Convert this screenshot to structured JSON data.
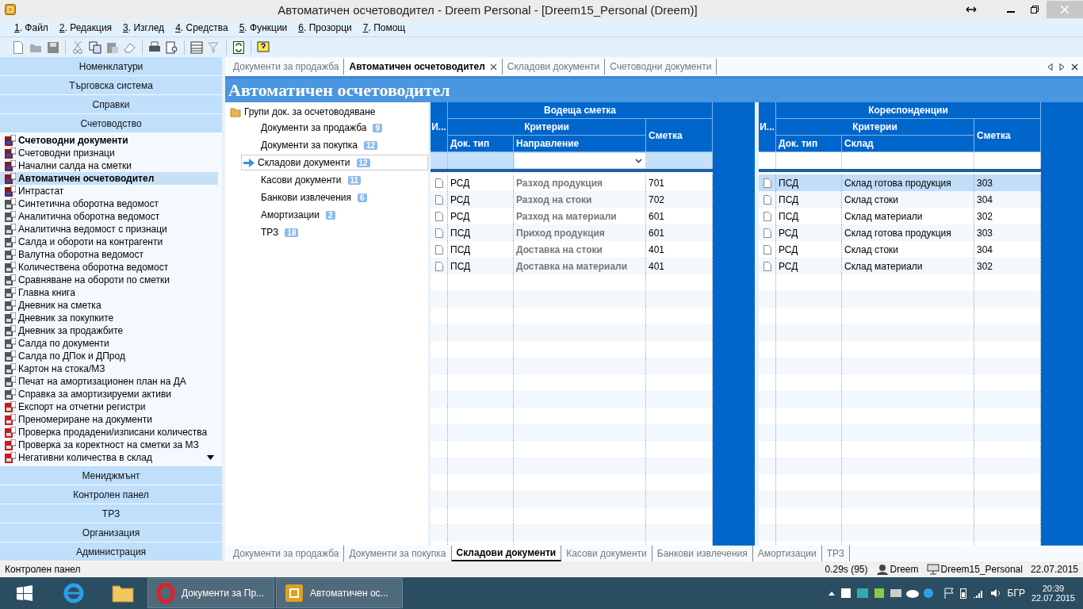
{
  "window": {
    "title": "Автоматичен осчетоводител - Dreem Personal - [Dreem15_Personal (Dreem)]"
  },
  "menu": [
    {
      "key": "1",
      "label": ". Файл"
    },
    {
      "key": "2",
      "label": ". Редакция"
    },
    {
      "key": "3",
      "label": ". Изглед"
    },
    {
      "key": "4",
      "label": ". Средства"
    },
    {
      "key": "5",
      "label": ". Функции"
    },
    {
      "key": "6",
      "label": ". Прозорци"
    },
    {
      "key": "7",
      "label": ". Помощ"
    }
  ],
  "sidebar": {
    "sections_top": [
      "Номенклатури",
      "Търговска система",
      "Справки",
      "Счетоводство"
    ],
    "items": [
      {
        "label": "Счетоводни документи",
        "kind": "ledger",
        "bold": true,
        "selected": false
      },
      {
        "label": "Счетоводни признаци",
        "kind": "ledger",
        "bold": false,
        "selected": false
      },
      {
        "label": "Начални салда на сметки",
        "kind": "ledger",
        "bold": false,
        "selected": false
      },
      {
        "label": "Автоматичен осчетоводител",
        "kind": "ledger",
        "bold": true,
        "selected": true
      },
      {
        "label": "Интрастат",
        "kind": "ledger",
        "bold": false,
        "selected": false
      },
      {
        "label": "Синтетична оборотна ведомост",
        "kind": "report",
        "bold": false,
        "selected": false
      },
      {
        "label": "Аналитична оборотна ведомост",
        "kind": "report",
        "bold": false,
        "selected": false
      },
      {
        "label": "Аналитична ведомост с признаци",
        "kind": "report",
        "bold": false,
        "selected": false
      },
      {
        "label": "Салда и обороти на контрагенти",
        "kind": "report",
        "bold": false,
        "selected": false
      },
      {
        "label": "Валутна оборотна ведомост",
        "kind": "report",
        "bold": false,
        "selected": false
      },
      {
        "label": "Количествена оборотна ведомост",
        "kind": "report",
        "bold": false,
        "selected": false
      },
      {
        "label": "Сравняване на обороти по сметки",
        "kind": "report",
        "bold": false,
        "selected": false
      },
      {
        "label": "Главна книга",
        "kind": "report",
        "bold": false,
        "selected": false
      },
      {
        "label": "Дневник на сметка",
        "kind": "report",
        "bold": false,
        "selected": false
      },
      {
        "label": "Дневник за покупките",
        "kind": "report",
        "bold": false,
        "selected": false
      },
      {
        "label": "Дневник за продажбите",
        "kind": "report",
        "bold": false,
        "selected": false
      },
      {
        "label": "Салда по документи",
        "kind": "report",
        "bold": false,
        "selected": false
      },
      {
        "label": "Салда по ДПок и ДПрод",
        "kind": "report",
        "bold": false,
        "selected": false
      },
      {
        "label": "Картон на стока/МЗ",
        "kind": "report",
        "bold": false,
        "selected": false
      },
      {
        "label": "Печат на амортизационен план на ДА",
        "kind": "report",
        "bold": false,
        "selected": false
      },
      {
        "label": "Справка за амортизируеми активи",
        "kind": "report",
        "bold": false,
        "selected": false
      },
      {
        "label": "Експорт на отчетни регистри",
        "kind": "function",
        "bold": false,
        "selected": false
      },
      {
        "label": "Преномериране на документи",
        "kind": "function",
        "bold": false,
        "selected": false
      },
      {
        "label": "Проверка продадени/изписани количества",
        "kind": "function",
        "bold": false,
        "selected": false
      },
      {
        "label": "Проверка за коректност на сметки за МЗ",
        "kind": "function",
        "bold": false,
        "selected": false
      },
      {
        "label": "Негативни количества в склад",
        "kind": "function",
        "bold": false,
        "selected": false
      }
    ],
    "sections_bottom": [
      "Мениджмънт",
      "Контролен панел",
      "ТРЗ",
      "Организация",
      "Администрация"
    ]
  },
  "tabs": [
    {
      "label": "Документи за продажба",
      "selected": false,
      "closable": false
    },
    {
      "label": "Автоматичен осчетоводител",
      "selected": true,
      "closable": true
    },
    {
      "label": "Складови документи",
      "selected": false,
      "closable": false
    },
    {
      "label": "Счетоводни документи",
      "selected": false,
      "closable": false
    }
  ],
  "page_title": "Автоматичен осчетоводител",
  "tree": {
    "root": "Групи док. за осчетоводяване",
    "children": [
      {
        "label": "Документи за продажба",
        "count": "9",
        "selected": false
      },
      {
        "label": "Документи за покупка",
        "count": "12",
        "selected": false
      },
      {
        "label": "Складови документи",
        "count": "12",
        "selected": true
      },
      {
        "label": "Касови документи",
        "count": "11",
        "selected": false
      },
      {
        "label": "Банкови извлечения",
        "count": "6",
        "selected": false
      },
      {
        "label": "Амортизации",
        "count": "2",
        "selected": false
      },
      {
        "label": "ТРЗ",
        "count": "18",
        "selected": false
      }
    ]
  },
  "lead_grid": {
    "title": "Водеща сметка",
    "group": "Критерии",
    "columns": [
      "И...",
      "Док. тип",
      "Направление",
      "Сметка"
    ],
    "filter_dropdown": true,
    "rows": [
      {
        "doc_type": "РСД",
        "criterion": "Разход продукция",
        "account": "701",
        "selected": false
      },
      {
        "doc_type": "РСД",
        "criterion": "Разход на стоки",
        "account": "702",
        "selected": false
      },
      {
        "doc_type": "РСД",
        "criterion": "Разход на материали",
        "account": "601",
        "selected": false
      },
      {
        "doc_type": "ПСД",
        "criterion": "Приход продукция",
        "account": "601",
        "selected": false
      },
      {
        "doc_type": "ПСД",
        "criterion": "Доставка на стоки",
        "account": "401",
        "selected": false
      },
      {
        "doc_type": "ПСД",
        "criterion": "Доставка на материали",
        "account": "401",
        "selected": false
      }
    ]
  },
  "corr_grid": {
    "title": "Кореспонденции",
    "group": "Критерии",
    "columns": [
      "И...",
      "Док. тип",
      "Склад",
      "Сметка"
    ],
    "filter_dropdown": false,
    "rows": [
      {
        "doc_type": "ПСД",
        "criterion": "Склад готова продукция",
        "account": "303",
        "selected": true
      },
      {
        "doc_type": "ПСД",
        "criterion": "Склад стоки",
        "account": "304",
        "selected": false
      },
      {
        "doc_type": "ПСД",
        "criterion": "Склад материали",
        "account": "302",
        "selected": false
      },
      {
        "doc_type": "РСД",
        "criterion": "Склад готова продукция",
        "account": "303",
        "selected": false
      },
      {
        "doc_type": "РСД",
        "criterion": "Склад стоки",
        "account": "304",
        "selected": false
      },
      {
        "doc_type": "РСД",
        "criterion": "Склад материали",
        "account": "302",
        "selected": false
      }
    ]
  },
  "bottom_tabs": [
    {
      "label": "Документи за продажба",
      "selected": false
    },
    {
      "label": "Документи за покупка",
      "selected": false
    },
    {
      "label": "Складови документи",
      "selected": true
    },
    {
      "label": "Касови документи",
      "selected": false
    },
    {
      "label": "Банкови извлечения",
      "selected": false
    },
    {
      "label": "Амортизации",
      "selected": false
    },
    {
      "label": "ТРЗ",
      "selected": false
    }
  ],
  "status_bar": {
    "left": "Контролен панел",
    "timing": "0.29s (95)",
    "user": "Dreem",
    "database": "Dreem15_Personal",
    "date": "22.07.2015"
  },
  "taskbar": {
    "windows": [
      {
        "label": "Документи за Пр...",
        "kind": "opera"
      },
      {
        "label": "Автоматичен ос...",
        "kind": "dreem"
      }
    ],
    "language": "БГР",
    "time": "20:39",
    "date": "22.07.2015"
  }
}
